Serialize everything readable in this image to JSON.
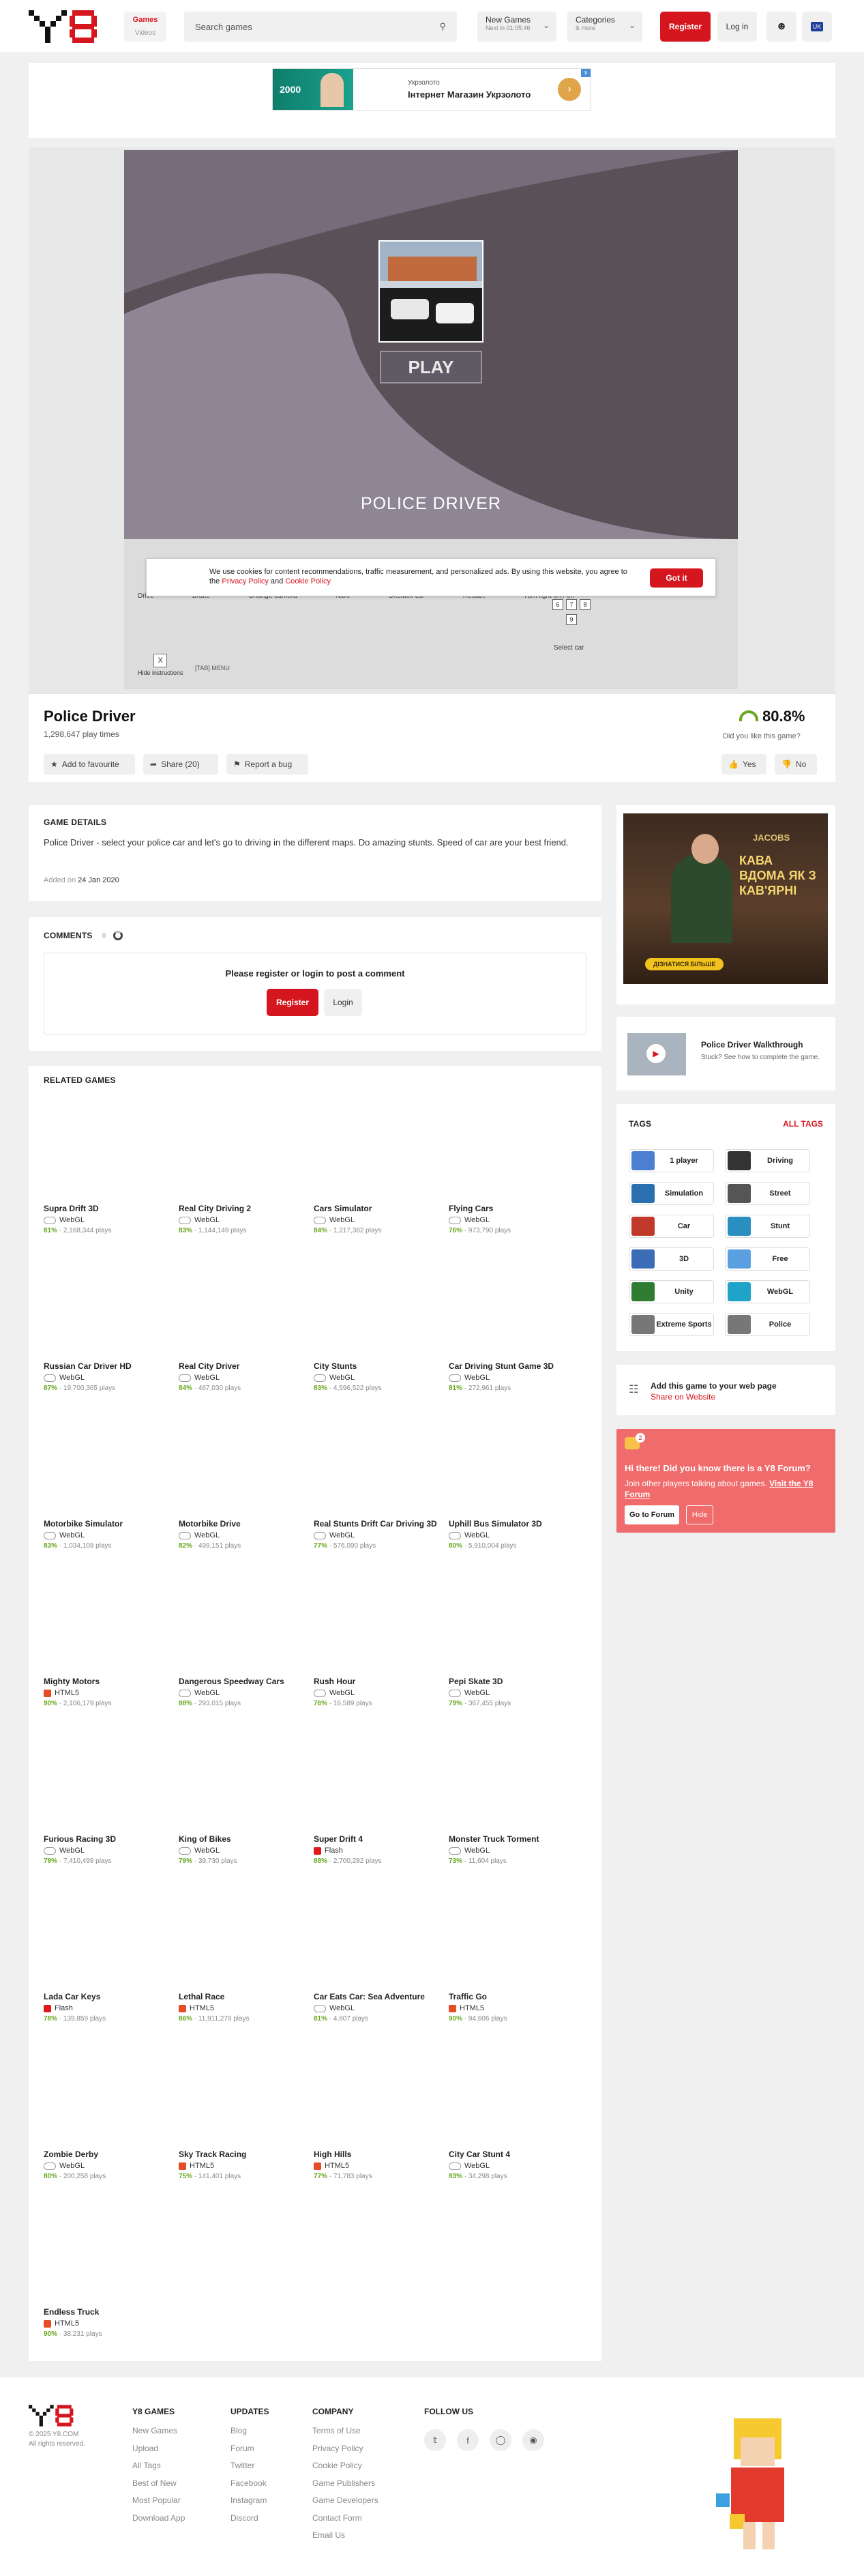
{
  "header": {
    "games_label": "Games",
    "videos_label": "Videos",
    "search_placeholder": "Search games",
    "new_games": {
      "label": "New Games",
      "sub": "Next in 01:05:46"
    },
    "categories": {
      "label": "Categories",
      "sub": "& more"
    },
    "register_label": "Register",
    "login_label": "Log in",
    "language": "UK"
  },
  "top_ad": {
    "brand": "Укрзолото",
    "text": "Інтернет Магазин Укрзолото",
    "badge": "2000"
  },
  "game": {
    "canvas_title": "POLICE DRIVER",
    "play_label": "PLAY",
    "cookie_text": "We use cookies for content recommendations, traffic measurement, and personalized ads. By using this website, you agree to the",
    "cookie_link1": "Privacy Policy",
    "cookie_and": "and",
    "cookie_link2": "Cookie Policy",
    "cookie_button": "Got it",
    "controls": [
      "Drive",
      "Brake",
      "Change camera",
      "Nitro",
      "Unstuck car",
      "Restart",
      "Turn light on / off"
    ],
    "keys": [
      "3",
      "4",
      "5",
      "6",
      "7",
      "8",
      "9"
    ],
    "select_car": "Select car",
    "hide_instructions": "Hide instructions",
    "tab_menu": "[TAB] MENU",
    "close_x": "X"
  },
  "info": {
    "title": "Police Driver",
    "plays": "1,298,647 play times",
    "fav": "Add to favourite",
    "share": "Share (20)",
    "report": "Report a bug",
    "rating": "80.8%",
    "rating_q": "Did you like this game?",
    "yes": "Yes",
    "no": "No"
  },
  "details": {
    "heading": "GAME DETAILS",
    "description": "Police Driver - select your police car and let's go to driving in the different maps. Do amazing stunts. Speed of car are your best friend.",
    "added_label": "Added on",
    "added_date": "24 Jan 2020"
  },
  "comments": {
    "heading": "COMMENTS",
    "count": "0",
    "prompt": "Please register or login to post a comment",
    "register": "Register",
    "login": "Login"
  },
  "related": {
    "heading": "RELATED GAMES",
    "games": [
      {
        "title": "Supra Drift 3D",
        "tech": "WebGL",
        "rating": "81%",
        "plays": "2,168,344 plays"
      },
      {
        "title": "Real City Driving 2",
        "tech": "WebGL",
        "rating": "83%",
        "plays": "1,144,149 plays"
      },
      {
        "title": "Cars Simulator",
        "tech": "WebGL",
        "rating": "84%",
        "plays": "1,217,382 plays"
      },
      {
        "title": "Flying Cars",
        "tech": "WebGL",
        "rating": "76%",
        "plays": "973,790 plays"
      },
      {
        "title": "Russian Car Driver HD",
        "tech": "WebGL",
        "rating": "87%",
        "plays": "19,700,365 plays"
      },
      {
        "title": "Real City Driver",
        "tech": "WebGL",
        "rating": "84%",
        "plays": "467,030 plays"
      },
      {
        "title": "City Stunts",
        "tech": "WebGL",
        "rating": "83%",
        "plays": "4,596,522 plays"
      },
      {
        "title": "Car Driving Stunt Game 3D",
        "tech": "WebGL",
        "rating": "81%",
        "plays": "272,961 plays"
      },
      {
        "title": "Motorbike Simulator",
        "tech": "WebGL",
        "rating": "83%",
        "plays": "1,034,108 plays"
      },
      {
        "title": "Motorbike Drive",
        "tech": "WebGL",
        "rating": "82%",
        "plays": "499,151 plays"
      },
      {
        "title": "Real Stunts Drift Car Driving 3D",
        "tech": "WebGL",
        "rating": "77%",
        "plays": "576,090 plays"
      },
      {
        "title": "Uphill Bus Simulator 3D",
        "tech": "WebGL",
        "rating": "80%",
        "plays": "5,910,004 plays"
      },
      {
        "title": "Mighty Motors",
        "tech": "HTML5",
        "rating": "90%",
        "plays": "2,106,179 plays"
      },
      {
        "title": "Dangerous Speedway Cars",
        "tech": "WebGL",
        "rating": "88%",
        "plays": "293,015 plays"
      },
      {
        "title": "Rush Hour",
        "tech": "WebGL",
        "rating": "76%",
        "plays": "16,589 plays"
      },
      {
        "title": "Pepi Skate 3D",
        "tech": "WebGL",
        "rating": "79%",
        "plays": "367,455 plays"
      },
      {
        "title": "Furious Racing 3D",
        "tech": "WebGL",
        "rating": "79%",
        "plays": "7,410,499 plays"
      },
      {
        "title": "King of Bikes",
        "tech": "WebGL",
        "rating": "79%",
        "plays": "39,730 plays"
      },
      {
        "title": "Super Drift 4",
        "tech": "Flash",
        "rating": "88%",
        "plays": "2,700,282 plays"
      },
      {
        "title": "Monster Truck Torment",
        "tech": "WebGL",
        "rating": "73%",
        "plays": "11,604 plays"
      },
      {
        "title": "Lada Car Keys",
        "tech": "Flash",
        "rating": "78%",
        "plays": "139,859 plays"
      },
      {
        "title": "Lethal Race",
        "tech": "HTML5",
        "rating": "86%",
        "plays": "11,911,279 plays"
      },
      {
        "title": "Car Eats Car: Sea Adventure",
        "tech": "WebGL",
        "rating": "81%",
        "plays": "4,607 plays"
      },
      {
        "title": "Traffic Go",
        "tech": "HTML5",
        "rating": "90%",
        "plays": "94,606 plays"
      },
      {
        "title": "Zombie Derby",
        "tech": "WebGL",
        "rating": "80%",
        "plays": "200,258 plays"
      },
      {
        "title": "Sky Track Racing",
        "tech": "HTML5",
        "rating": "75%",
        "plays": "141,401 plays"
      },
      {
        "title": "High Hills",
        "tech": "HTML5",
        "rating": "77%",
        "plays": "71,783 plays"
      },
      {
        "title": "City Car Stunt 4",
        "tech": "WebGL",
        "rating": "83%",
        "plays": "34,298 plays"
      },
      {
        "title": "Endless Truck",
        "tech": "HTML5",
        "rating": "90%",
        "plays": "38,231 plays"
      }
    ]
  },
  "side_ad": {
    "headline": "КАВА ВДОМА ЯК З КАВ'ЯРНІ",
    "brand": "JACOBS",
    "cta": "ДІЗНАТИСЯ БІЛЬШЕ"
  },
  "walkthrough": {
    "title": "Police Driver Walkthrough",
    "text": "Stuck? See how to complete the game."
  },
  "tags": {
    "heading": "TAGS",
    "all": "ALL TAGS",
    "items": [
      "1 player",
      "Driving",
      "Simulation",
      "Street",
      "Car",
      "Stunt",
      "3D",
      "Free",
      "Unity",
      "WebGL",
      "Extreme Sports",
      "Police"
    ]
  },
  "embed": {
    "title": "Add this game to your web page",
    "link": "Share on Website"
  },
  "forum": {
    "badge": "2",
    "title": "Hi there! Did you know there is a Y8 Forum?",
    "text": "Join other players talking about games.",
    "link": "Visit the Y8 Forum",
    "go": "Go to Forum",
    "hide": "Hide"
  },
  "footer": {
    "copyright": "© 2025 Y8.COM",
    "rights": "All rights reserved.",
    "col1": {
      "title": "Y8 GAMES",
      "links": [
        "New Games",
        "Upload",
        "All Tags",
        "Best of New",
        "Most Popular",
        "Download App"
      ]
    },
    "col2": {
      "title": "UPDATES",
      "links": [
        "Blog",
        "Forum",
        "Twitter",
        "Facebook",
        "Instagram",
        "Discord"
      ]
    },
    "col3": {
      "title": "COMPANY",
      "links": [
        "Terms of Use",
        "Privacy Policy",
        "Cookie Policy",
        "Game Publishers",
        "Game Developers",
        "Contact Form",
        "Email Us"
      ]
    },
    "col4": {
      "title": "FOLLOW US"
    }
  },
  "colors": {
    "brand_red": "#d6161e",
    "rating_green": "#66a71d",
    "forum_bg": "#f06b6b"
  }
}
